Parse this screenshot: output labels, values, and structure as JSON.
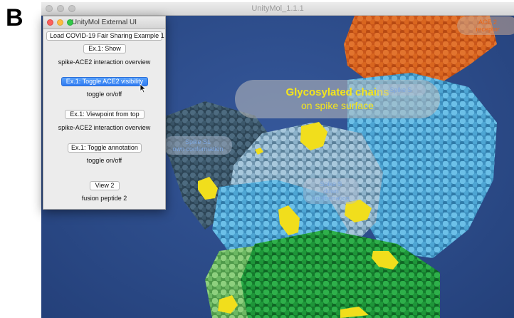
{
  "panel_letter": "B",
  "app_window": {
    "title": "UnityMol_1.1.1"
  },
  "viewport": {
    "glyco_label": {
      "title": "Glycosylated chains",
      "subtitle": "on spike surface"
    },
    "ace2_label": {
      "line1": "ACE 2",
      "line2": "receptor"
    },
    "spike_s1_label": {
      "line1": "Spike S1",
      "line2": "own conformation"
    },
    "spike_s2_label": {
      "line1": "Spike S",
      "line2": "down conformation"
    },
    "spike_s3_label": {
      "line1": "Spike S",
      "line2": ""
    }
  },
  "external_ui": {
    "title": "UnityMol External UI",
    "load_button": "Load COVID-19 Fair Sharing Example 1",
    "items": [
      {
        "button": "Ex.1: Show",
        "description": "spike-ACE2 interaction overview",
        "active": false
      },
      {
        "button": "Ex.1: Toggle ACE2 visibility",
        "description": "toggle on/off",
        "active": true
      },
      {
        "button": "Ex.1: Viewpoint from top",
        "description": "spike-ACE2 interaction overview",
        "active": false
      },
      {
        "button": "Ex.1: Toggle annotation",
        "description": "toggle on/off",
        "active": false
      },
      {
        "button": "View 2",
        "description": "fusion peptide 2",
        "active": false
      }
    ]
  },
  "colors": {
    "background": "#2c4d8d",
    "ace2": "#d8651c",
    "spike_light_blue": "#5fb2dc",
    "spike_dark": "#3e5a6e",
    "spike_green": "#1f9a3c",
    "glycans": "#f1de1c",
    "label_yellow": "#f4e51c"
  }
}
